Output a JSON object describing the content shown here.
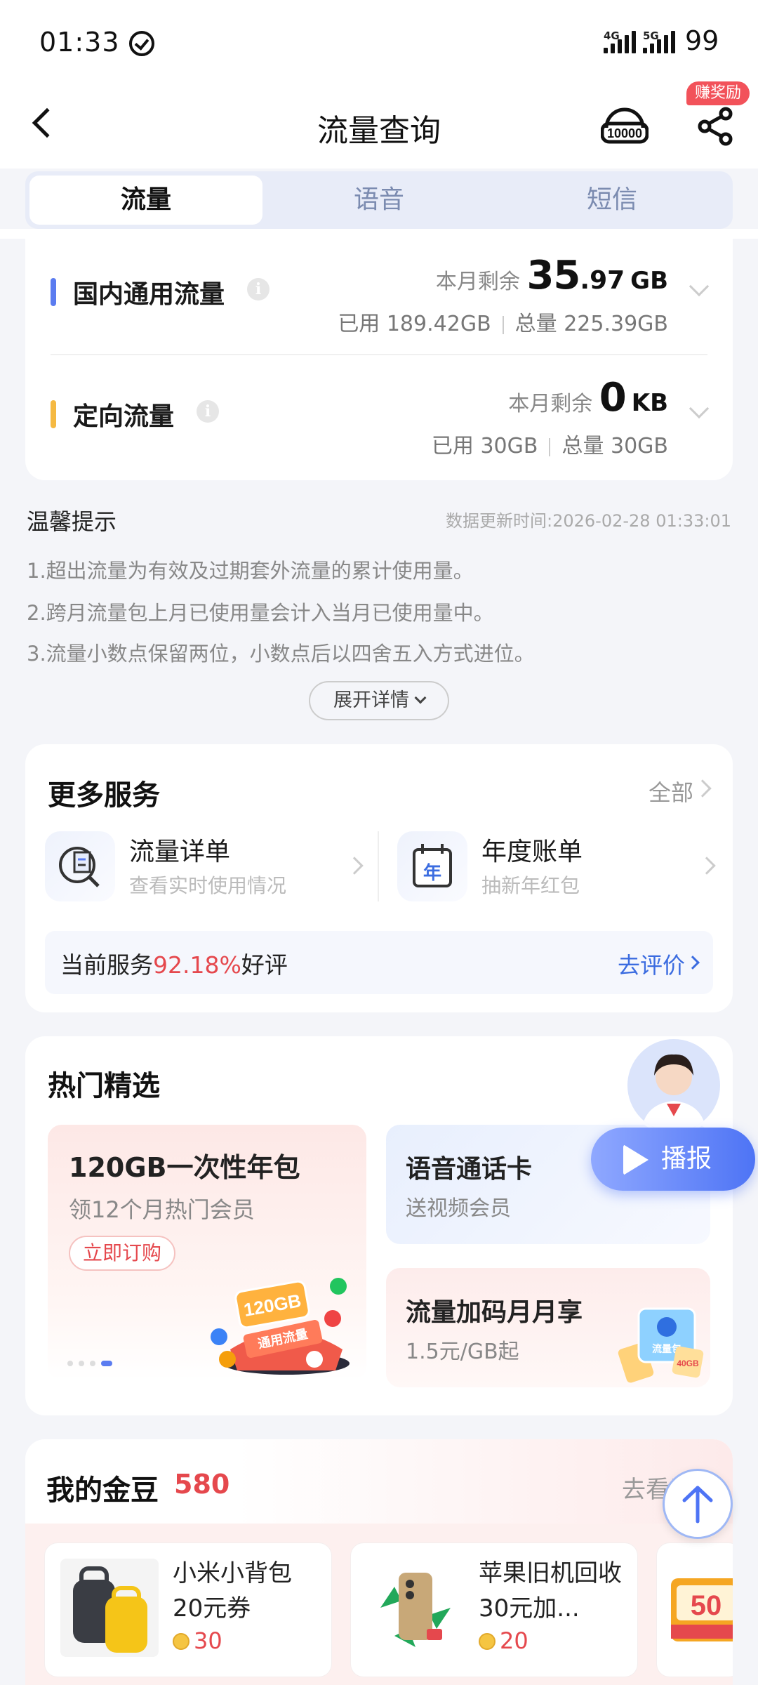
{
  "status_bar": {
    "time": "01:33",
    "net1": "4G",
    "net2": "5G",
    "battery": "99"
  },
  "nav": {
    "title": "流量查询",
    "reward_badge": "赚奖励",
    "cs_icon": "10000-customer-service-icon",
    "share_icon": "share-icon"
  },
  "tabs": [
    {
      "label": "流量",
      "active": true
    },
    {
      "label": "语音",
      "active": false
    },
    {
      "label": "短信",
      "active": false
    }
  ],
  "usage": [
    {
      "name": "国内通用流量",
      "color": "#5b7cf0",
      "remain_label": "本月剩余",
      "remain_int": "35",
      "remain_dec": ".97",
      "unit": "GB",
      "used": "已用 189.42GB",
      "total": "总量 225.39GB"
    },
    {
      "name": "定向流量",
      "color": "#f5b942",
      "remain_label": "本月剩余",
      "remain_int": "0",
      "remain_dec": "",
      "unit": "KB",
      "used": "已用 30GB",
      "total": "总量 30GB"
    }
  ],
  "tips": {
    "title": "温馨提示",
    "updated": "数据更新时间:2026-02-28 01:33:01",
    "items": [
      "1.超出流量为有效及过期套外流量的累计使用量。",
      "2.跨月流量包上月已使用量会计入当月已使用量中。",
      "3.流量小数点保留两位，小数点后以四舍五入方式进位。"
    ],
    "expand": "展开详情"
  },
  "services": {
    "title": "更多服务",
    "all": "全部",
    "items": [
      {
        "name": "流量详单",
        "sub": "查看实时使用情况"
      },
      {
        "name": "年度账单",
        "sub": "抽新年红包",
        "icon_text": "年"
      }
    ],
    "rating_prefix": "当前服务",
    "rating_pct": "92.18%",
    "rating_suffix": "好评",
    "rate_btn": "去评价"
  },
  "hot": {
    "title": "热门精选",
    "big": {
      "title": "120GB一次性年包",
      "sub": "领12个月热门会员",
      "btn": "立即订购",
      "img_text": "120GB",
      "img_text2": "通用流量"
    },
    "small": [
      {
        "title": "语音通话卡",
        "sub": "送视频会员"
      },
      {
        "title": "流量加码月月享",
        "sub": "1.5元/GB起",
        "img_text": "流量包",
        "img_text2": "40GB"
      }
    ],
    "broadcast": "播报"
  },
  "beans": {
    "title": "我的金豆",
    "count": "580",
    "go": "去看看",
    "goods": [
      {
        "name": "小米小背包20元券",
        "price": "30"
      },
      {
        "name": "苹果旧机回收30元加...",
        "price": "20"
      },
      {
        "name": "",
        "price": "",
        "img_text": "50"
      }
    ]
  }
}
